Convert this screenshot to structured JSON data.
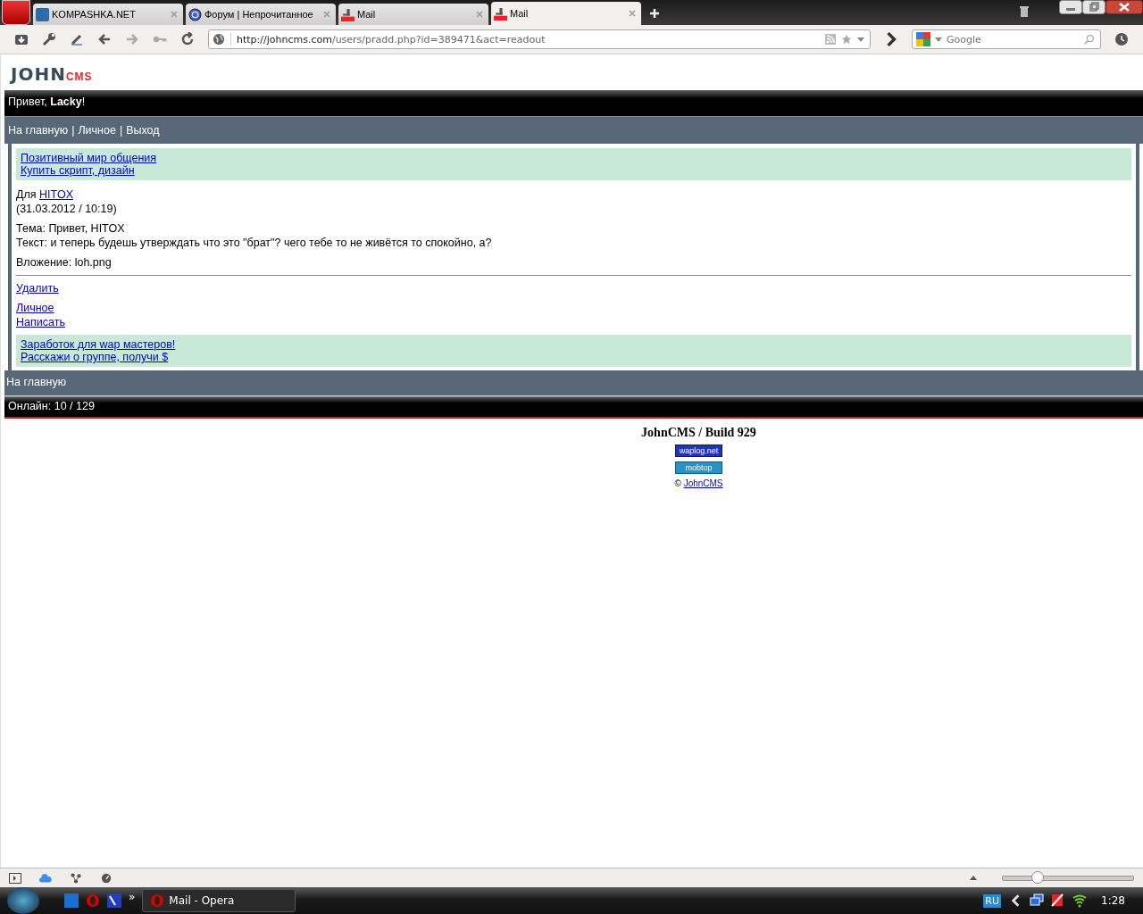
{
  "browser": {
    "tabs": [
      {
        "title": "KOMPASHKA.NET",
        "kind": "k",
        "selected": false
      },
      {
        "title": "Форум | Непрочитанное",
        "kind": "globe",
        "selected": false
      },
      {
        "title": "Mail",
        "kind": "cms",
        "selected": false
      },
      {
        "title": "Mail",
        "kind": "cms",
        "selected": true
      }
    ],
    "address": {
      "host": "http://johncms.com",
      "path": "/users/pradd.php?id=389471&act=readout"
    },
    "search": {
      "placeholder": "Google"
    },
    "zoom": {
      "level": 0.27
    }
  },
  "page": {
    "logo": {
      "main": "JOHN",
      "accent": "CMS"
    },
    "greeting": "Привет, **Lacky**!",
    "nav": {
      "items": [
        "На главную",
        "Личное",
        "Выход"
      ],
      "separator": "|"
    },
    "ads_top": [
      "Позитивный мир общения",
      "Купить скрипт, дизайн"
    ],
    "message": {
      "to_label": "Для",
      "to_user": "HITOX",
      "date": "(31.03.2012 / 10:19)",
      "subject": "Тема: Привет, HITOX",
      "text": "Текст: и теперь будешь утверждать что это \"брат\"? чего тебе то не живётся то спокойно, а?",
      "attachment": "Вложение: loh.png"
    },
    "delete_link": "Удалить",
    "links": [
      "Личное",
      "Написать"
    ],
    "ads_bottom": [
      "Заработок для wap мастеров!",
      "Расскажи о группе, получи $"
    ],
    "footer_nav": "На главную",
    "online": "Онлайн: 10 / 129",
    "build": "JohnCMS / Build 929",
    "counters": [
      {
        "kind": "waplog",
        "label": "waplog.net"
      },
      {
        "kind": "mobtop",
        "label": "mobtop"
      }
    ],
    "copyright": {
      "sign": "©",
      "link": "JohnCMS"
    }
  },
  "taskbar": {
    "window": "Mail - Opera",
    "more": "»",
    "language": "RU",
    "clock": "1:28"
  }
}
